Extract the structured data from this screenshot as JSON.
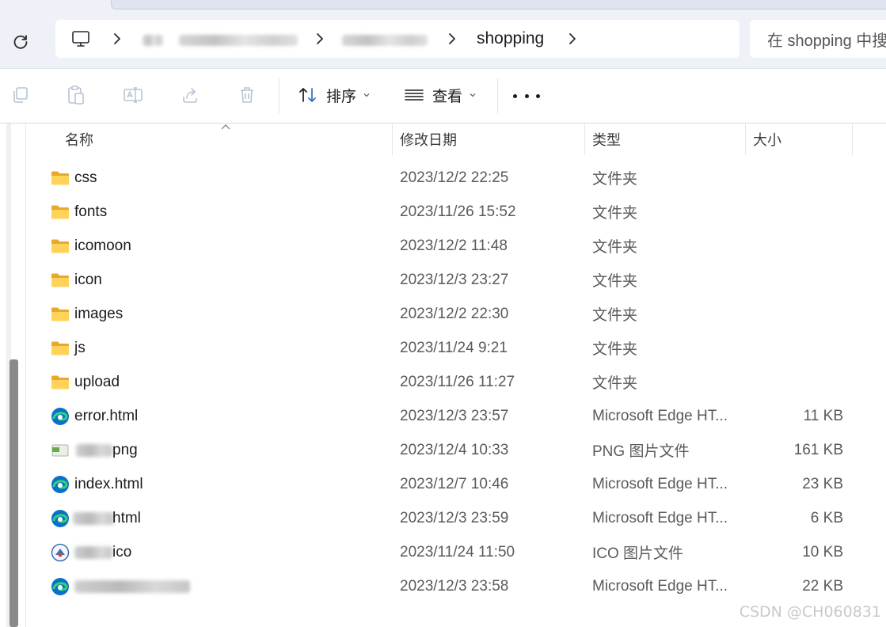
{
  "address_bar": {
    "current_folder": "shopping",
    "search_placeholder": "在 shopping 中搜"
  },
  "toolbar": {
    "sort_label": "排序",
    "view_label": "查看"
  },
  "columns": {
    "name": "名称",
    "modified": "修改日期",
    "type": "类型",
    "size": "大小"
  },
  "files": [
    {
      "name": "css",
      "date": "2023/12/2 22:25",
      "type": "文件夹",
      "size": "",
      "icon": "folder-icon"
    },
    {
      "name": "fonts",
      "date": "2023/11/26 15:52",
      "type": "文件夹",
      "size": "",
      "icon": "folder-icon"
    },
    {
      "name": "icomoon",
      "date": "2023/12/2 11:48",
      "type": "文件夹",
      "size": "",
      "icon": "folder-icon"
    },
    {
      "name": "icon",
      "date": "2023/12/3 23:27",
      "type": "文件夹",
      "size": "",
      "icon": "folder-icon"
    },
    {
      "name": "images",
      "date": "2023/12/2 22:30",
      "type": "文件夹",
      "size": "",
      "icon": "folder-icon"
    },
    {
      "name": "js",
      "date": "2023/11/24 9:21",
      "type": "文件夹",
      "size": "",
      "icon": "folder-icon"
    },
    {
      "name": "upload",
      "date": "2023/11/26 11:27",
      "type": "文件夹",
      "size": "",
      "icon": "folder-icon"
    },
    {
      "name": "error.html",
      "date": "2023/12/3 23:57",
      "type": "Microsoft Edge HT...",
      "size": "11 KB",
      "icon": "edge-icon"
    },
    {
      "name": "png",
      "date": "2023/12/4 10:33",
      "type": "PNG 图片文件",
      "size": "161 KB",
      "icon": "png-file-icon"
    },
    {
      "name": "index.html",
      "date": "2023/12/7 10:46",
      "type": "Microsoft Edge HT...",
      "size": "23 KB",
      "icon": "edge-icon"
    },
    {
      "name": "html",
      "date": "2023/12/3 23:59",
      "type": "Microsoft Edge HT...",
      "size": "6 KB",
      "icon": "edge-icon"
    },
    {
      "name": "ico",
      "date": "2023/11/24 11:50",
      "type": "ICO 图片文件",
      "size": "10 KB",
      "icon": "ico-file-icon"
    },
    {
      "name": "",
      "date": "2023/12/3 23:58",
      "type": "Microsoft Edge HT...",
      "size": "22 KB",
      "icon": "edge-icon"
    }
  ],
  "watermark": "CSDN @CH060831"
}
